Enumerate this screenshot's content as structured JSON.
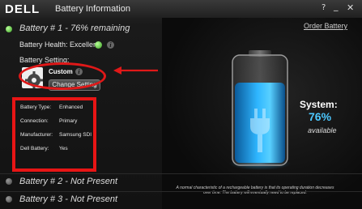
{
  "titlebar": {
    "logo": "DELL",
    "title": "Battery Information",
    "help": "?",
    "minimize": "_",
    "close": "✕"
  },
  "battery1": {
    "header": "Battery # 1 - 76% remaining",
    "order_link": "Order Battery",
    "health_label": "Battery Health: Excellent",
    "setting_label": "Battery Setting:",
    "setting_value": "Custom",
    "change_button": "Change Setting",
    "details": [
      {
        "key": "Battery Type:",
        "value": "Enhanced"
      },
      {
        "key": "Connection:",
        "value": "Primary"
      },
      {
        "key": "Manufacturer:",
        "value": "Samsung SDI"
      },
      {
        "key": "Dell Battery:",
        "value": "Yes"
      }
    ]
  },
  "battery2": {
    "header": "Battery # 2 - Not Present"
  },
  "battery3": {
    "header": "Battery # 3 - Not Present"
  },
  "system": {
    "label": "System:",
    "percent": "76%",
    "status": "available",
    "charge_level": 0.76
  },
  "note": "A normal characteristic of a rechargeable battery is that its operating duration decreases over time. The battery will eventually need to be replaced.",
  "colors": {
    "accent": "#4cc8ff",
    "annotation": "#e01818",
    "status_green": "#3aa020"
  },
  "icons": [
    "gear-icon",
    "check-icon",
    "info-icon",
    "plug-icon"
  ]
}
